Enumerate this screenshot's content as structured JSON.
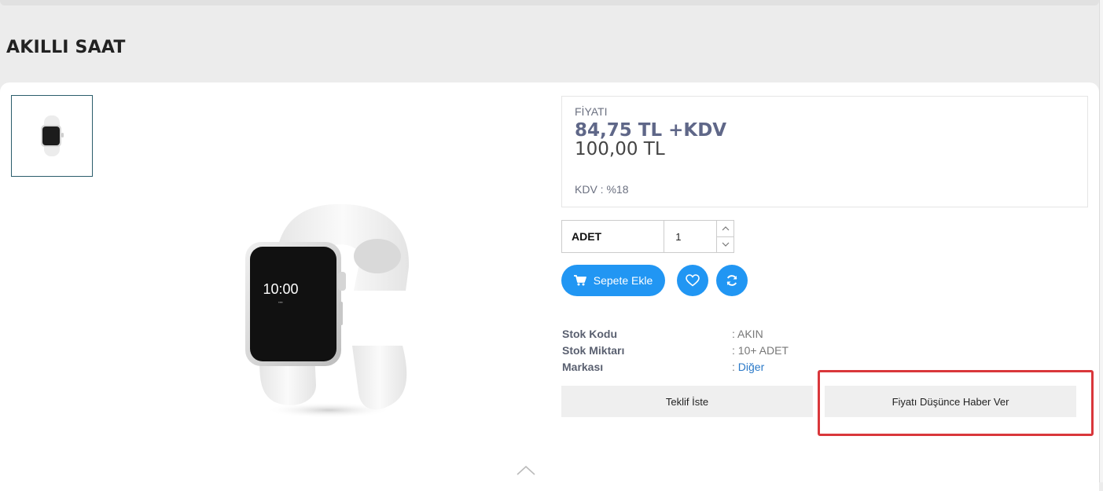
{
  "page": {
    "title": "AKILLI SAAT"
  },
  "gallery": {
    "thumbnail_alt": "watch-thumbnail",
    "main_watch_time": "10:00"
  },
  "price": {
    "label": "FİYATI",
    "main": "84,75 TL +KDV",
    "gross": "100,00 TL",
    "kdv": "KDV : %18"
  },
  "quantity": {
    "label": "ADET",
    "value": "1"
  },
  "actions": {
    "add_to_cart": "Sepete Ekle",
    "request_quote": "Teklif İste",
    "price_drop_alert": "Fiyatı Düşünce Haber Ver"
  },
  "info": [
    {
      "key": "Stok Kodu",
      "value": ": AKIN"
    },
    {
      "key": "Stok Miktarı",
      "value": ": 10+ ADET"
    },
    {
      "key": "Markası",
      "value_prefix": ": ",
      "link": "Diğer"
    }
  ],
  "icons": {
    "cart": "cart-icon",
    "favorite": "heart-icon",
    "compare": "refresh-icon",
    "scroll_up": "chevron-up-icon"
  },
  "colors": {
    "accent": "#2196f3",
    "highlight": "#d9373b",
    "price": "#5f6788",
    "link": "#2a79c8"
  }
}
